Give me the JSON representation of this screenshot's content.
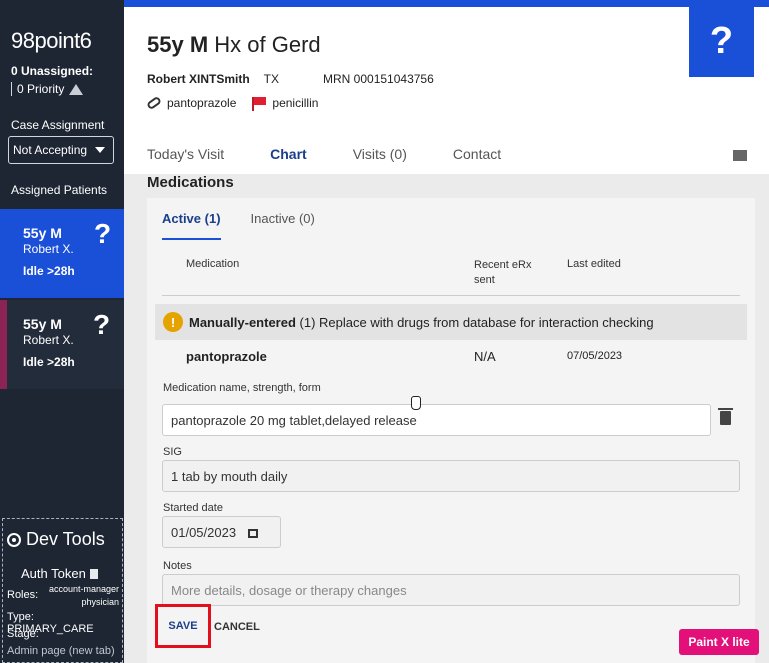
{
  "sidebar": {
    "brand": "98point6",
    "unassigned": "0 Unassigned:",
    "priority": "0 Priority",
    "case_assignment_label": "Case Assignment",
    "case_assignment_value": "Not Accepting",
    "assigned_patients_label": "Assigned Patients",
    "patients": [
      {
        "age_sex": "55y M",
        "name": "Robert X.",
        "idle": "Idle >28h",
        "icon": "?"
      },
      {
        "age_sex": "55y M",
        "name": "Robert X.",
        "idle": "Idle >28h",
        "icon": "?"
      }
    ],
    "dev_tools": {
      "title": "Dev Tools",
      "auth_token": "Auth Token",
      "roles_label": "Roles:",
      "roles_value_1": "account-manager",
      "roles_value_2": "physician",
      "type": "Type: PRIMARY_CARE",
      "stage": "Stage:",
      "admin_link": "Admin page (new tab)"
    }
  },
  "header": {
    "title_bold": "55y M",
    "title_rest": " Hx of Gerd",
    "patient_name": "Robert XINTSmith",
    "state": "TX",
    "mrn": "MRN 000151043756",
    "medication": "pantoprazole",
    "allergy": "penicillin",
    "help_icon": "?"
  },
  "tabs": [
    "Today's Visit",
    "Chart",
    "Visits (0)",
    "Contact"
  ],
  "medications": {
    "section_title": "Medications",
    "sub_tabs": [
      "Active (1)",
      "Inactive (0)"
    ],
    "columns": {
      "medication": "Medication",
      "recent_erx": "Recent eRx sent",
      "last_edited": "Last edited"
    },
    "warning_bold": "Manually-entered",
    "warning_rest": " (1) Replace with drugs from database for interaction checking",
    "row": {
      "name": "pantoprazole",
      "erx": "N/A",
      "last_edited": "07/05/2023"
    },
    "form": {
      "name_label": "Medication name, strength, form",
      "name_value": "pantoprazole 20 mg tablet,delayed release",
      "sig_label": "SIG",
      "sig_value": "1 tab by mouth daily",
      "started_label": "Started date",
      "started_value": "01/05/2023",
      "notes_label": "Notes",
      "notes_placeholder": "More details, dosage or therapy changes"
    },
    "save": "SAVE",
    "cancel": "CANCEL"
  },
  "overlay_badge": "Paint X lite",
  "colors": {
    "accent": "#1a4fd8",
    "sidebar": "#1e2633",
    "highlight": "#e2101c",
    "warning": "#e5a300"
  }
}
